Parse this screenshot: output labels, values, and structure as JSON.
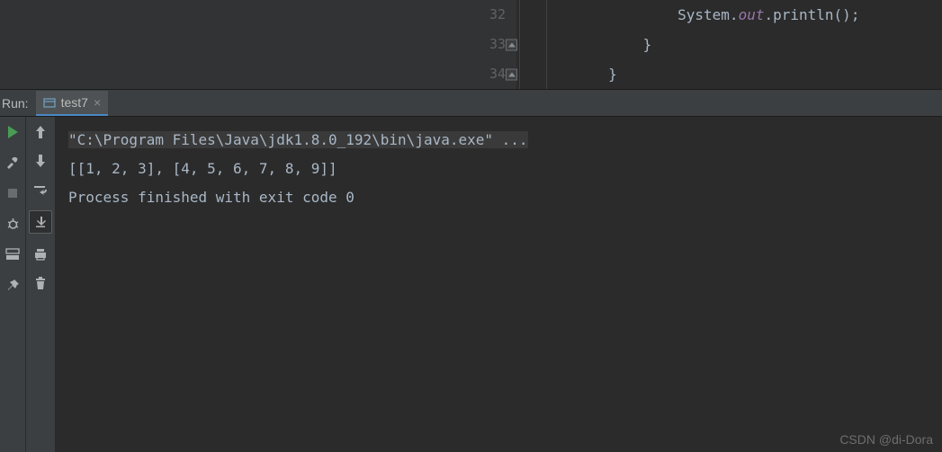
{
  "editor": {
    "lines": [
      {
        "num": "32",
        "indent": "                ",
        "tokens": [
          {
            "t": "System",
            "c": "kw"
          },
          {
            "t": ".",
            "c": "dot"
          },
          {
            "t": "out",
            "c": "static-field"
          },
          {
            "t": ".",
            "c": "dot"
          },
          {
            "t": "println",
            "c": "method"
          },
          {
            "t": "();",
            "c": "paren"
          }
        ]
      },
      {
        "num": "33",
        "indent": "            ",
        "tokens": [
          {
            "t": "}",
            "c": "brace"
          }
        ],
        "fold": true
      },
      {
        "num": "34",
        "indent": "        ",
        "tokens": [
          {
            "t": "}",
            "c": "brace"
          }
        ],
        "fold": true
      }
    ]
  },
  "run": {
    "label": "Run:",
    "tab": {
      "name": "test7"
    }
  },
  "console": {
    "cmd": "\"C:\\Program Files\\Java\\jdk1.8.0_192\\bin\\java.exe\" ...",
    "output": "[[1, 2, 3], [4, 5, 6, 7, 8, 9]]",
    "blank": "",
    "exit": "Process finished with exit code 0"
  },
  "watermark": "CSDN @di-Dora"
}
